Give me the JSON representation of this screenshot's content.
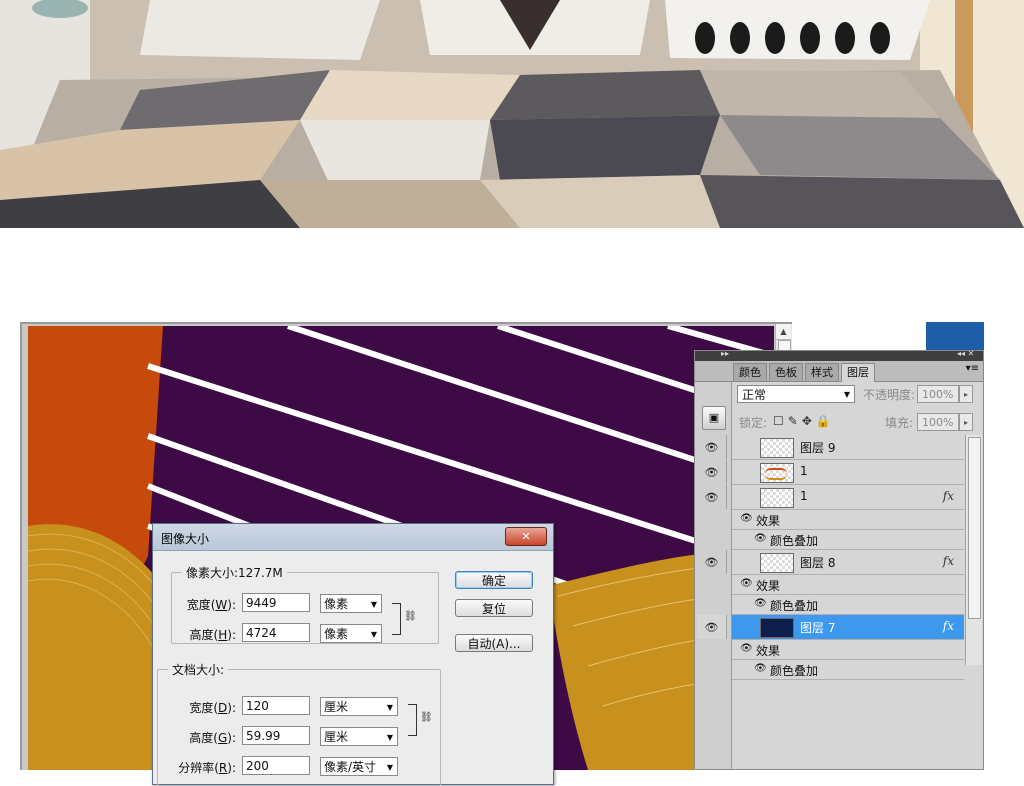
{
  "dialog": {
    "title": "图像大小",
    "close_label": "✕",
    "pixel_group_label": "像素大小:127.7M",
    "width_label": "宽度(",
    "width_key": "W",
    "height_label": "高度(",
    "height_key": "H",
    "pixel_width": "9449",
    "pixel_height": "4724",
    "pixel_unit": "像素",
    "doc_group_label": "文档大小:",
    "doc_width_label": "宽度(",
    "doc_width_key": "D",
    "doc_height_label": "高度(",
    "doc_height_key": "G",
    "doc_width": "120",
    "doc_height": "59.99",
    "doc_unit": "厘米",
    "resolution_label": "分辨率(",
    "resolution_key": "R",
    "resolution": "200",
    "resolution_unit": "像素/英寸",
    "label_close": "):",
    "ok_label": "确定",
    "reset_label": "复位",
    "auto_label": "自动(A)..."
  },
  "layers_panel": {
    "tabs": [
      "颜色",
      "色板",
      "样式",
      "图层"
    ],
    "active_tab": "图层",
    "blend_mode": "正常",
    "opacity_label": "不透明度:",
    "opacity": "100%",
    "lock_label": "锁定:",
    "fill_label": "填充:",
    "fill": "100%",
    "layers": [
      {
        "name": "图层 9",
        "thumb": "checker",
        "fx": false,
        "effects": []
      },
      {
        "name": "1",
        "thumb": "doodle",
        "fx": false,
        "effects": []
      },
      {
        "name": "1",
        "thumb": "checker",
        "fx": true,
        "effects": [
          "效果",
          "颜色叠加"
        ]
      },
      {
        "name": "图层 8",
        "thumb": "checker",
        "fx": true,
        "effects": [
          "效果",
          "颜色叠加"
        ]
      },
      {
        "name": "图层 7",
        "thumb": "navy",
        "fx": true,
        "effects": [
          "效果",
          "颜色叠加"
        ],
        "selected": true
      }
    ],
    "fx_label": "fx"
  },
  "icons": {
    "eye": "eye-icon",
    "link": "chain-link-icon",
    "folder": "folder-icon",
    "menu": "panel-menu-icon"
  },
  "colors": {
    "canvas_purple": "#3d0a45",
    "canvas_orange": "#c54a0c",
    "canvas_gold": "#c8901c",
    "selection": "#3d98ee"
  }
}
